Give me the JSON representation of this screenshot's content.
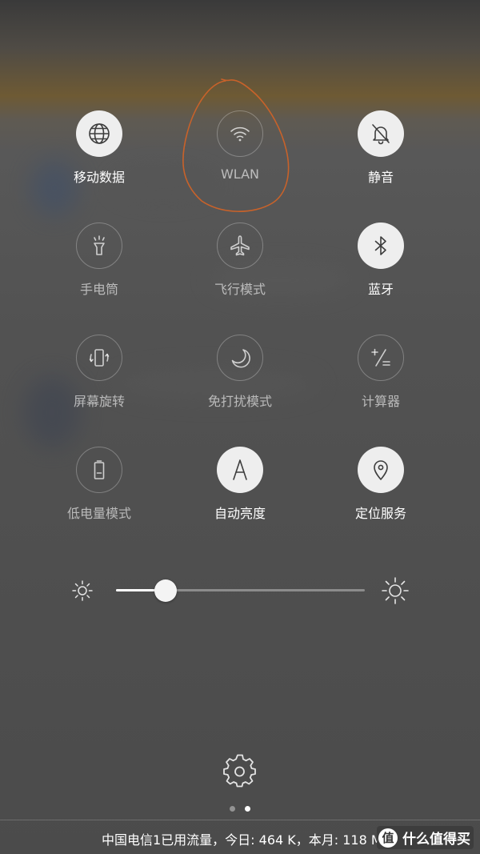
{
  "tiles": [
    {
      "label": "移动数据",
      "icon": "globe-icon",
      "state": "on"
    },
    {
      "label": "WLAN",
      "icon": "wifi-icon",
      "state": "off"
    },
    {
      "label": "静音",
      "icon": "bell-off-icon",
      "state": "on"
    },
    {
      "label": "手电筒",
      "icon": "flashlight-icon",
      "state": "off"
    },
    {
      "label": "飞行模式",
      "icon": "airplane-icon",
      "state": "off"
    },
    {
      "label": "蓝牙",
      "icon": "bluetooth-icon",
      "state": "on"
    },
    {
      "label": "屏幕旋转",
      "icon": "rotate-icon",
      "state": "off"
    },
    {
      "label": "免打扰模式",
      "icon": "moon-icon",
      "state": "off"
    },
    {
      "label": "计算器",
      "icon": "calculator-icon",
      "state": "off"
    },
    {
      "label": "低电量模式",
      "icon": "battery-icon",
      "state": "off"
    },
    {
      "label": "自动亮度",
      "icon": "auto-brightness-icon",
      "state": "on"
    },
    {
      "label": "定位服务",
      "icon": "location-icon",
      "state": "on"
    }
  ],
  "brightness": {
    "level": 0.2
  },
  "pager": {
    "pages": 2,
    "current": 2
  },
  "footer": {
    "data_usage": "中国电信1已用流量，今日: 464 K，本月: 118 M",
    "watermark_text": "什么值得买",
    "watermark_logo": "值"
  },
  "colors": {
    "tile_on_bg": "#eeeeee",
    "annotation_stroke": "#c8622a"
  }
}
